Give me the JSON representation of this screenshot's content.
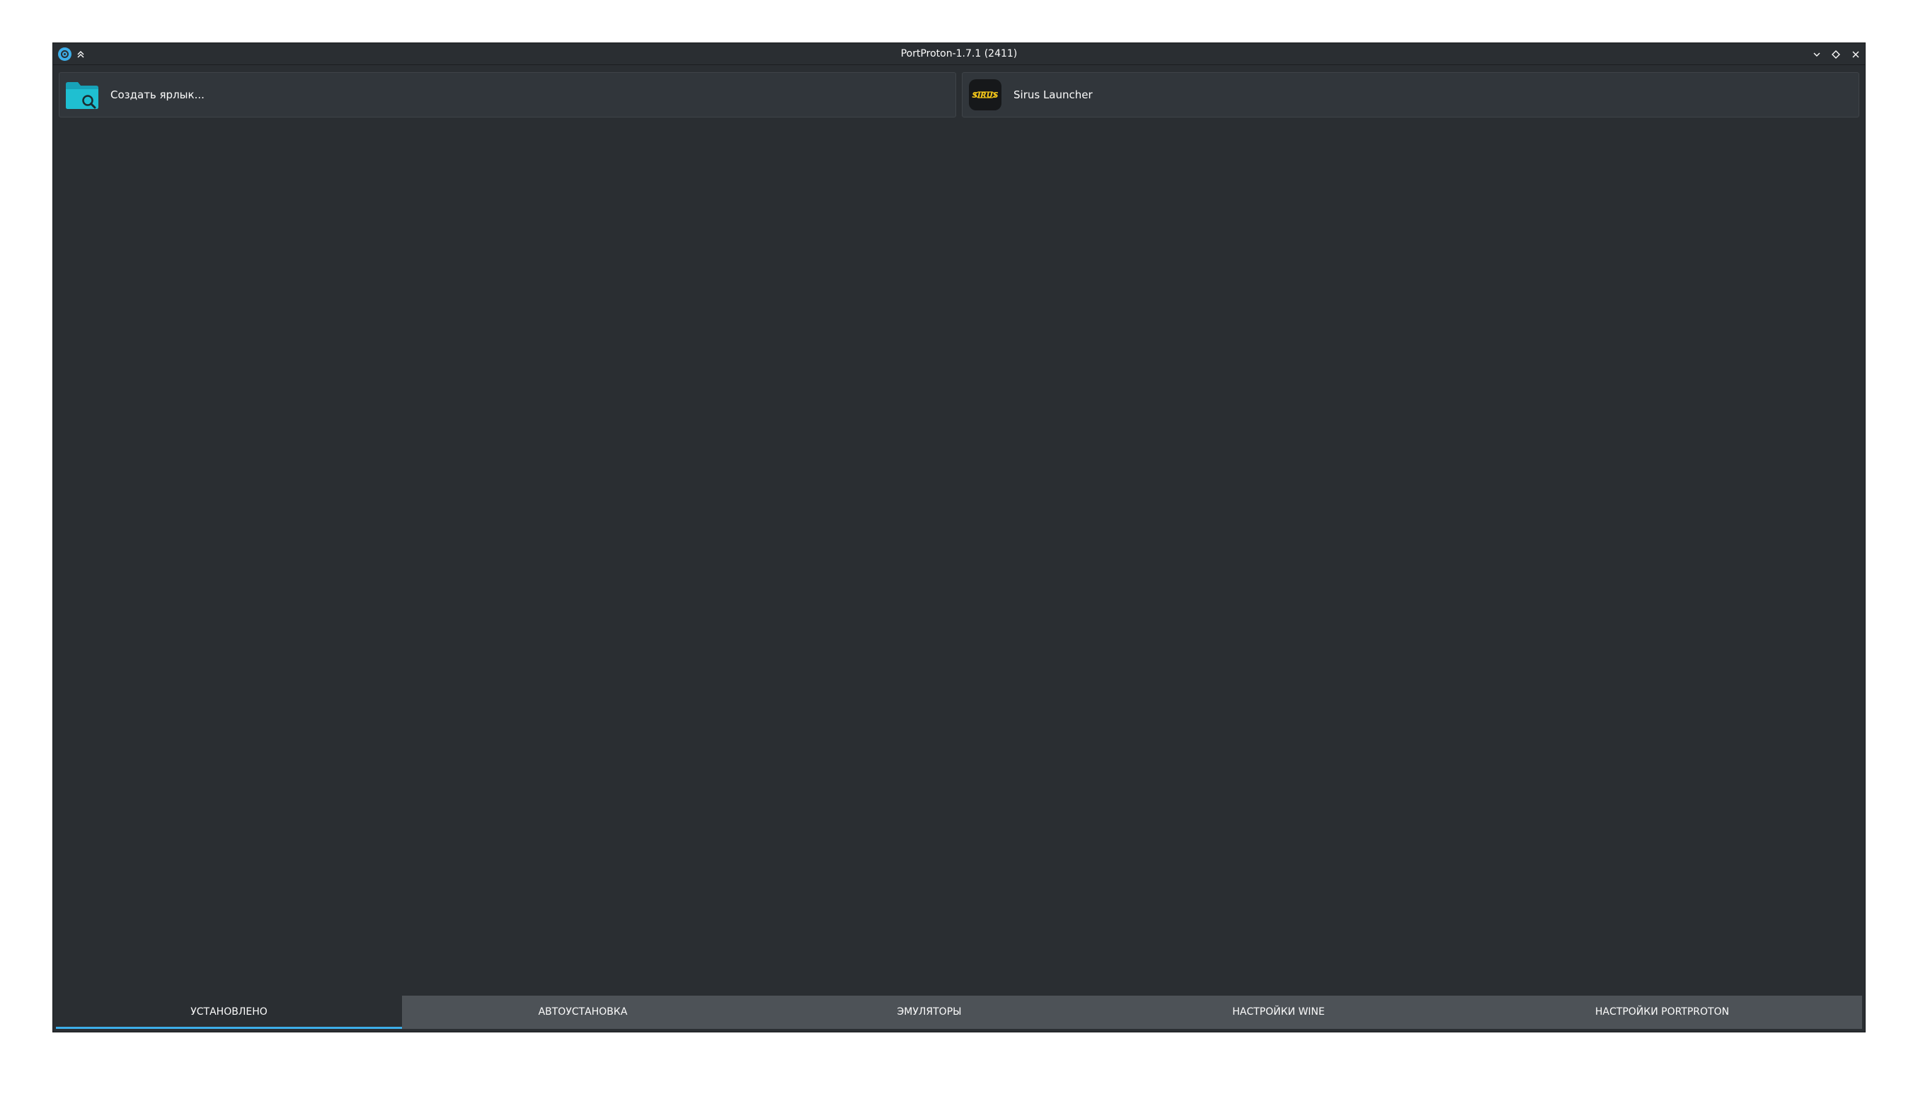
{
  "window": {
    "title": "PortProton-1.7.1 (2411)"
  },
  "titlebar_icons": {
    "app": "portproton-app-icon",
    "keep_above": "chevrons-up-icon",
    "minimize": "chevron-down-icon",
    "maximize": "diamond-icon",
    "close": "close-icon"
  },
  "shortcuts": [
    {
      "label": "Создать ярлык...",
      "icon": "folder-search-icon"
    },
    {
      "label": "Sirus Launcher",
      "icon": "sirus-logo-icon"
    }
  ],
  "tabs": [
    {
      "label": "УСТАНОВЛЕНО",
      "active": true
    },
    {
      "label": "АВТОУСТАНОВКА",
      "active": false
    },
    {
      "label": "ЭМУЛЯТОРЫ",
      "active": false
    },
    {
      "label": "НАСТРОЙКИ WINE",
      "active": false
    },
    {
      "label": "НАСТРОЙКИ PORTPROTON",
      "active": false
    }
  ],
  "colors": {
    "background": "#2a2e32",
    "tab_bar": "#4d5257",
    "accent": "#3daee9",
    "folder_icon": "#1eb4c8",
    "sirus_logo": "#f0c419"
  }
}
